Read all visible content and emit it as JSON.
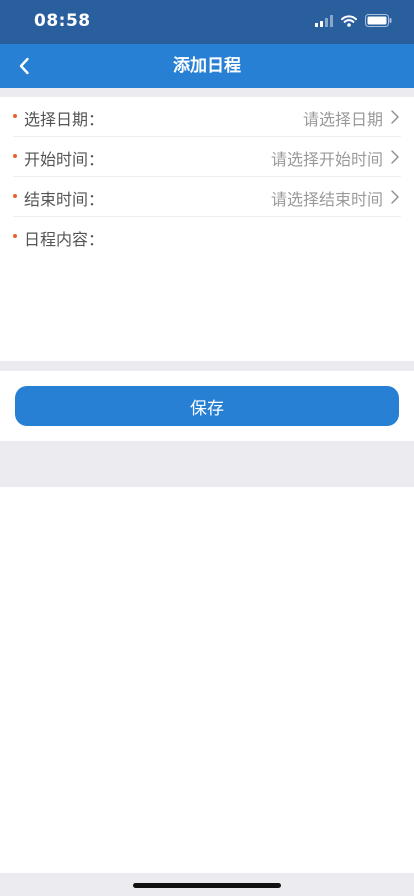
{
  "status_bar": {
    "time": "08:58",
    "icons": [
      "cellular-signal-icon",
      "wifi-icon",
      "battery-icon"
    ]
  },
  "nav": {
    "title": "添加日程",
    "back_icon": "chevron-left-icon"
  },
  "form": {
    "required_marker": "•",
    "rows": [
      {
        "label": "选择日期：",
        "placeholder": "请选择日期"
      },
      {
        "label": "开始时间：",
        "placeholder": "请选择开始时间"
      },
      {
        "label": "结束时间：",
        "placeholder": "请选择结束时间"
      },
      {
        "label": "日程内容："
      }
    ]
  },
  "actions": {
    "save_label": "保存"
  },
  "colors": {
    "status_bar_bg": "#2a5f9e",
    "nav_bar_bg": "#2780d4",
    "accent": "#2780d4",
    "required_dot": "#e8612c",
    "divider_bg": "#ececf0"
  }
}
